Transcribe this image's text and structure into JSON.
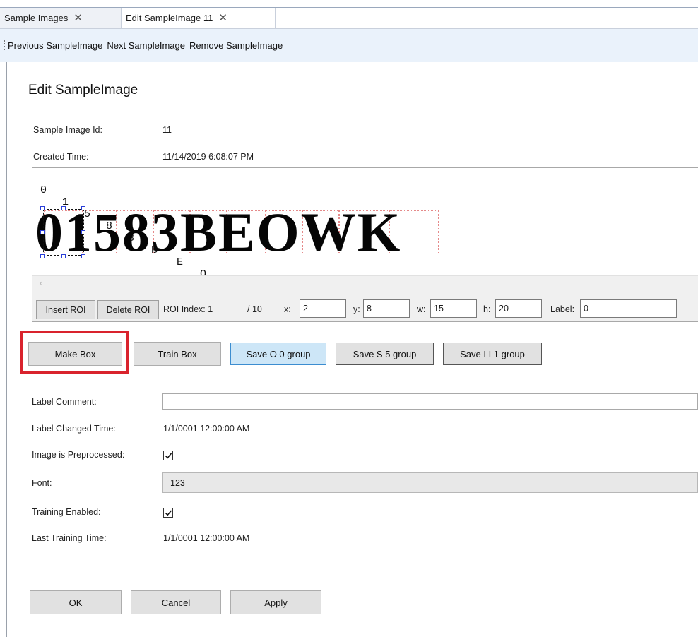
{
  "tabs": [
    {
      "label": "Sample Images"
    },
    {
      "label": "Edit SampleImage 11"
    }
  ],
  "toolbar": {
    "previous": "Previous SampleImage",
    "next": "Next SampleImage",
    "remove": "Remove SampleImage"
  },
  "page_title": "Edit SampleImage",
  "details": {
    "id_label": "Sample Image Id:",
    "id_value": "11",
    "created_label": "Created Time:",
    "created_value": "11/14/2019 6:08:07 PM"
  },
  "image": {
    "letters_row": "0 1 5 8 3 B E O W K",
    "rendered_text": "01583BEOWK"
  },
  "roi_bar": {
    "insert": "Insert ROI",
    "delete": "Delete ROI",
    "index_label": "ROI Index: 1",
    "total": "/ 10",
    "x_label": "x:",
    "x_value": "2",
    "y_label": "y:",
    "y_value": "8",
    "w_label": "w:",
    "w_value": "15",
    "h_label": "h:",
    "h_value": "20",
    "label_label": "Label:",
    "label_value": "0"
  },
  "actions": {
    "make_box": "Make Box",
    "train_box": "Train Box",
    "save_o": "Save O 0 group",
    "save_s": "Save S 5 group",
    "save_i": "Save I I 1 group"
  },
  "form": {
    "label_comment": "Label Comment:",
    "label_comment_value": "",
    "label_changed": "Label Changed Time:",
    "label_changed_value": "1/1/0001 12:00:00 AM",
    "preprocessed": "Image is Preprocessed:",
    "preprocessed_checked": true,
    "font": "Font:",
    "font_value": "123",
    "training_enabled": "Training Enabled:",
    "training_enabled_checked": true,
    "last_training": "Last Training Time:",
    "last_training_value": "1/1/0001 12:00:00 AM"
  },
  "footer": {
    "ok": "OK",
    "cancel": "Cancel",
    "apply": "Apply"
  },
  "icons": {
    "close": "close-icon",
    "checkmark": "checkmark-icon",
    "scroll_left": "chevron-left-icon"
  },
  "colors": {
    "highlight": "#d9232d",
    "active_button": "#cde6f7",
    "handle": "#2a3fd8"
  }
}
